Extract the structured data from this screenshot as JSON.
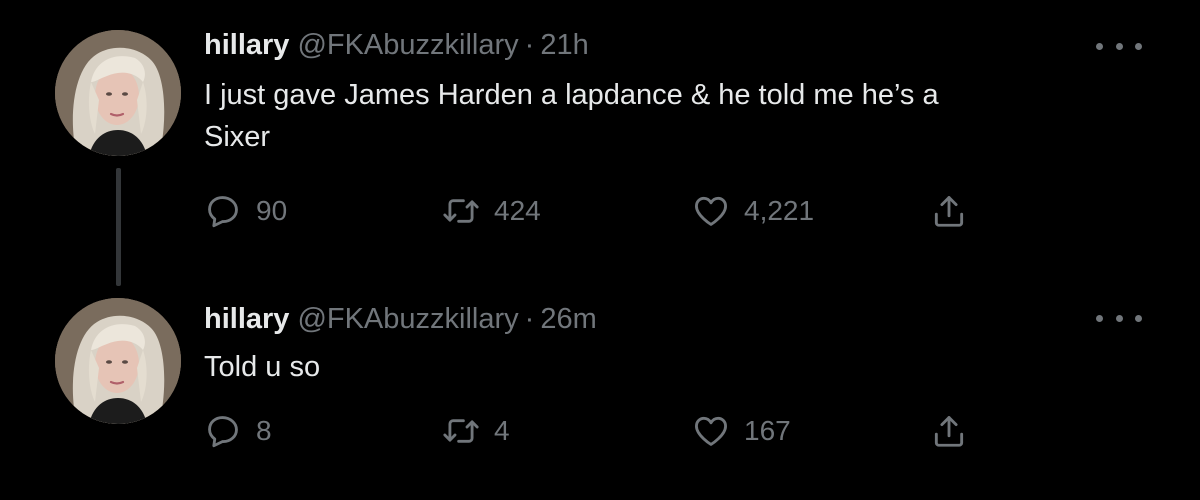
{
  "colors": {
    "background": "#000000",
    "primary_text": "#e7e9ea",
    "secondary_text": "#71767b",
    "thread_line": "#333639"
  },
  "tweets": [
    {
      "display_name": "hillary",
      "handle": "@FKAbuzzkillary",
      "separator": "·",
      "time": "21h",
      "text": "I just gave James Harden a lapdance & he told me he’s a\nSixer",
      "reply_count": "90",
      "retweet_count": "424",
      "like_count": "4,221",
      "icons": [
        "reply-icon",
        "retweet-icon",
        "like-icon",
        "share-icon",
        "more-icon"
      ]
    },
    {
      "display_name": "hillary",
      "handle": "@FKAbuzzkillary",
      "separator": "·",
      "time": "26m",
      "text": "Told u so",
      "reply_count": "8",
      "retweet_count": "4",
      "like_count": "167",
      "icons": [
        "reply-icon",
        "retweet-icon",
        "like-icon",
        "share-icon",
        "more-icon"
      ]
    }
  ]
}
